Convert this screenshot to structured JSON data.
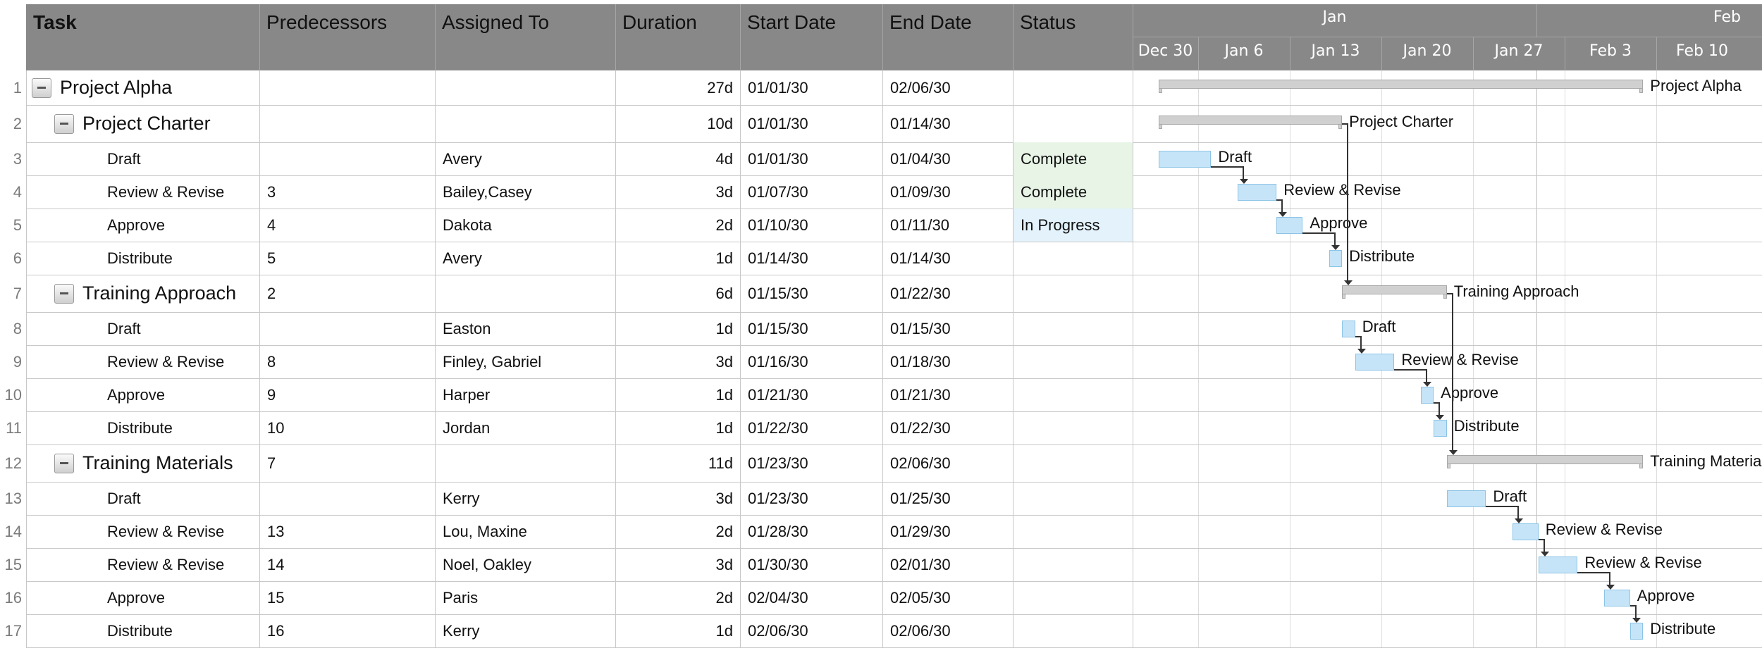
{
  "columns": [
    "Task",
    "Predecessors",
    "Assigned To",
    "Duration",
    "Start Date",
    "End Date",
    "Status"
  ],
  "timeline": {
    "months": [
      "Jan",
      "Feb"
    ],
    "weeks": [
      "Dec 30",
      "Jan 6",
      "Jan 13",
      "Jan 20",
      "Jan 27",
      "Feb 3",
      "Feb 10"
    ]
  },
  "colors": {
    "header_bg": "#888888",
    "summary_bar": "#d0d0d0",
    "task_bar": "#c6e4f7",
    "status_complete": "#e7f4e6",
    "status_in_progress": "#e3f2fb"
  },
  "rows": [
    {
      "num": "1",
      "task": "Project Alpha",
      "level": 0,
      "summary": true,
      "pred": "",
      "assigned": "",
      "duration": "27d",
      "start": "01/01/30",
      "end": "02/06/30",
      "status": ""
    },
    {
      "num": "2",
      "task": "Project Charter",
      "level": 1,
      "summary": true,
      "pred": "",
      "assigned": "",
      "duration": "10d",
      "start": "01/01/30",
      "end": "01/14/30",
      "status": ""
    },
    {
      "num": "3",
      "task": "Draft",
      "level": 2,
      "summary": false,
      "pred": "",
      "assigned": "Avery",
      "duration": "4d",
      "start": "01/01/30",
      "end": "01/04/30",
      "status": "Complete"
    },
    {
      "num": "4",
      "task": "Review & Revise",
      "level": 2,
      "summary": false,
      "pred": "3",
      "assigned": "Bailey,Casey",
      "duration": "3d",
      "start": "01/07/30",
      "end": "01/09/30",
      "status": "Complete"
    },
    {
      "num": "5",
      "task": "Approve",
      "level": 2,
      "summary": false,
      "pred": "4",
      "assigned": "Dakota",
      "duration": "2d",
      "start": "01/10/30",
      "end": "01/11/30",
      "status": "In Progress"
    },
    {
      "num": "6",
      "task": "Distribute",
      "level": 2,
      "summary": false,
      "pred": "5",
      "assigned": "Avery",
      "duration": "1d",
      "start": "01/14/30",
      "end": "01/14/30",
      "status": ""
    },
    {
      "num": "7",
      "task": "Training Approach",
      "level": 1,
      "summary": true,
      "pred": "2",
      "assigned": "",
      "duration": "6d",
      "start": "01/15/30",
      "end": "01/22/30",
      "status": ""
    },
    {
      "num": "8",
      "task": "Draft",
      "level": 2,
      "summary": false,
      "pred": "",
      "assigned": "Easton",
      "duration": "1d",
      "start": "01/15/30",
      "end": "01/15/30",
      "status": ""
    },
    {
      "num": "9",
      "task": "Review & Revise",
      "level": 2,
      "summary": false,
      "pred": "8",
      "assigned": "Finley, Gabriel",
      "duration": "3d",
      "start": "01/16/30",
      "end": "01/18/30",
      "status": ""
    },
    {
      "num": "10",
      "task": "Approve",
      "level": 2,
      "summary": false,
      "pred": "9",
      "assigned": "Harper",
      "duration": "1d",
      "start": "01/21/30",
      "end": "01/21/30",
      "status": ""
    },
    {
      "num": "11",
      "task": "Distribute",
      "level": 2,
      "summary": false,
      "pred": "10",
      "assigned": "Jordan",
      "duration": "1d",
      "start": "01/22/30",
      "end": "01/22/30",
      "status": ""
    },
    {
      "num": "12",
      "task": "Training Materials",
      "level": 1,
      "summary": true,
      "pred": "7",
      "assigned": "",
      "duration": "11d",
      "start": "01/23/30",
      "end": "02/06/30",
      "status": ""
    },
    {
      "num": "13",
      "task": "Draft",
      "level": 2,
      "summary": false,
      "pred": "",
      "assigned": "Kerry",
      "duration": "3d",
      "start": "01/23/30",
      "end": "01/25/30",
      "status": ""
    },
    {
      "num": "14",
      "task": "Review & Revise",
      "level": 2,
      "summary": false,
      "pred": "13",
      "assigned": "Lou, Maxine",
      "duration": "2d",
      "start": "01/28/30",
      "end": "01/29/30",
      "status": ""
    },
    {
      "num": "15",
      "task": "Review & Revise",
      "level": 2,
      "summary": false,
      "pred": "14",
      "assigned": "Noel, Oakley",
      "duration": "3d",
      "start": "01/30/30",
      "end": "02/01/30",
      "status": ""
    },
    {
      "num": "16",
      "task": "Approve",
      "level": 2,
      "summary": false,
      "pred": "15",
      "assigned": "Paris",
      "duration": "2d",
      "start": "02/04/30",
      "end": "02/05/30",
      "status": ""
    },
    {
      "num": "17",
      "task": "Distribute",
      "level": 2,
      "summary": false,
      "pred": "16",
      "assigned": "Kerry",
      "duration": "1d",
      "start": "02/06/30",
      "end": "02/06/30",
      "status": ""
    }
  ]
}
